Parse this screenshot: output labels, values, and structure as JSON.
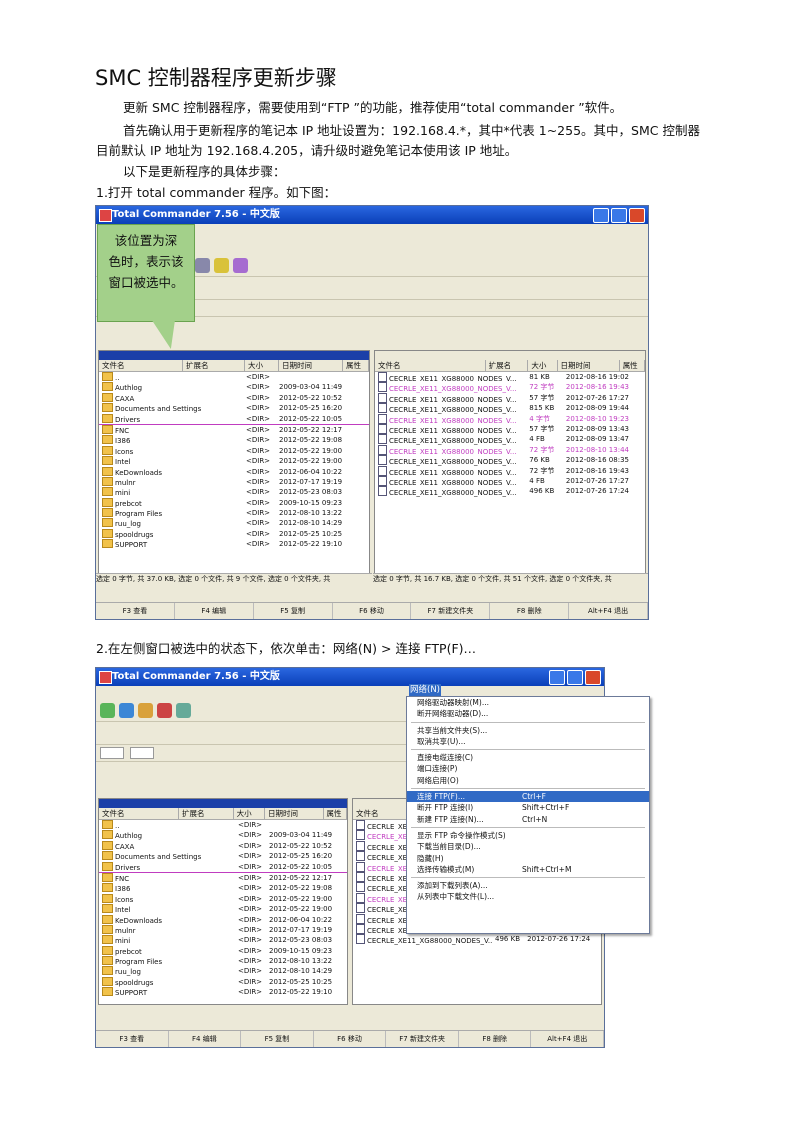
{
  "document": {
    "title": "SMC 控制器程序更新步骤",
    "para1": "更新 SMC 控制器程序，需要使用到“FTP ”的功能，推荐使用“total commander ”软件。",
    "para2_line1": "首先确认用于更新程序的笔记本 IP 地址设置为：192.168.4.*，其中*代表 1~255。其中，SMC 控制器",
    "para2_line2": "目前默认 IP 地址为 192.168.4.205，请升级时避免笔记本使用该 IP 地址。",
    "para3": "以下是更新程序的具体步骤：",
    "step1": "1.打开 total commander   程序。如下图：",
    "step2": "2.在左侧窗口被选中的状态下，依次单击：网络(N)     >  连接 FTP(F)…"
  },
  "screenshot1": {
    "window_title": "Total Commander 7.56 - 中文版",
    "callout": [
      "该位置为深",
      "色时，表示该",
      "窗口被选中。"
    ],
    "left_status": "选定 0 字节, 共 37.0 KB, 选定 0 个文件, 共 9 个文件, 选定 0 个文件夹, 共",
    "right_status": "选定 0 字节, 共 16.7 KB, 选定 0 个文件, 共 51 个文件, 选定 0 个文件夹, 共",
    "fn_keys": [
      "F3 查看",
      "F4 编辑",
      "F5 复制",
      "F6 移动",
      "F7 新建文件夹",
      "F8 删除",
      "Alt+F4 退出"
    ]
  },
  "screenshot2": {
    "window_title": "Total Commander 7.56 - 中文版",
    "network_menu": "网络(N)",
    "menu_items": [
      {
        "label": "网络驱动器映射(M)...",
        "shortcut": ""
      },
      {
        "label": "断开网络驱动器(D)...",
        "shortcut": ""
      },
      {
        "sep": true
      },
      {
        "label": "共享当前文件夹(S)...",
        "shortcut": ""
      },
      {
        "label": "取消共享(U)...",
        "shortcut": ""
      },
      {
        "sep": true
      },
      {
        "label": "直接电缆连接(C)",
        "shortcut": ""
      },
      {
        "label": "端口连接(P)",
        "shortcut": ""
      },
      {
        "label": "网络启用(O)",
        "shortcut": ""
      },
      {
        "sep": true
      },
      {
        "label": "连接 FTP(F)...",
        "shortcut": "Ctrl+F",
        "selected": true
      },
      {
        "label": "断开 FTP 连接(I)",
        "shortcut": "Shift+Ctrl+F"
      },
      {
        "label": "新建 FTP 连接(N)...",
        "shortcut": "Ctrl+N"
      },
      {
        "sep": true
      },
      {
        "label": "显示 FTP 命令操作模式(S)",
        "shortcut": ""
      },
      {
        "label": "下载当前目录(D)...",
        "shortcut": ""
      },
      {
        "label": "隐藏(H)",
        "shortcut": ""
      },
      {
        "label": "选择传输模式(M)",
        "shortcut": "Shift+Ctrl+M"
      },
      {
        "sep": true
      },
      {
        "label": "添加到下载列表(A)...",
        "shortcut": ""
      },
      {
        "label": "从列表中下载文件(L)...",
        "shortcut": ""
      }
    ],
    "fn_keys": [
      "F3 查看",
      "F4 编辑",
      "F5 复制",
      "F6 移动",
      "F7 新建文件夹",
      "F8 删除",
      "Alt+F4 退出"
    ]
  },
  "left_files": [
    {
      "name": "..",
      "size": "<DIR>",
      "date": ""
    },
    {
      "name": "Authlog",
      "size": "<DIR>",
      "date": "2009-03-04 11:49"
    },
    {
      "name": "CAXA",
      "size": "<DIR>",
      "date": "2012-05-22 10:52"
    },
    {
      "name": "Documents and Settings",
      "size": "<DIR>",
      "date": "2012-05-25 16:20"
    },
    {
      "name": "Drivers",
      "size": "<DIR>",
      "date": "2012-05-22 10:05"
    },
    {
      "name": "FNC",
      "size": "<DIR>",
      "date": "2012-05-22 12:17"
    },
    {
      "name": "I386",
      "size": "<DIR>",
      "date": "2012-05-22 19:08"
    },
    {
      "name": "Icons",
      "size": "<DIR>",
      "date": "2012-05-22 19:00"
    },
    {
      "name": "Intel",
      "size": "<DIR>",
      "date": "2012-05-22 19:00"
    },
    {
      "name": "KeDownloads",
      "size": "<DIR>",
      "date": "2012-06-04 10:22"
    },
    {
      "name": "mulnr",
      "size": "<DIR>",
      "date": "2012-07-17 19:19"
    },
    {
      "name": "mini",
      "size": "<DIR>",
      "date": "2012-05-23 08:03"
    },
    {
      "name": "prebcot",
      "size": "<DIR>",
      "date": "2009-10-15 09:23"
    },
    {
      "name": "Program Files",
      "size": "<DIR>",
      "date": "2012-08-10 13:22"
    },
    {
      "name": "ruu_log",
      "size": "<DIR>",
      "date": "2012-08-10 14:29"
    },
    {
      "name": "spooldrugs",
      "size": "<DIR>",
      "date": "2012-05-25 10:25"
    },
    {
      "name": "SUPPORT",
      "size": "<DIR>",
      "date": "2012-05-22 19:10"
    }
  ],
  "right_files": [
    {
      "name": "CECRLE_XE11_XG88000_NODES_V...",
      "size": "81 KB",
      "date": "2012-08-16 19:02"
    },
    {
      "name": "CECRLE_XE11_XG88000_NODES_V...",
      "size": "72 字节",
      "date": "2012-08-16 19:43"
    },
    {
      "name": "CECRLE_XE11_XG88000_NODES_V...",
      "size": "57 字节",
      "date": "2012-07-26 17:27"
    },
    {
      "name": "CECRLE_XE11_XG88000_NODES_V...",
      "size": "815 KB",
      "date": "2012-08-09 19:44"
    },
    {
      "name": "CECRLE_XE11_XG88000_NODES_V...",
      "size": "4 字节",
      "date": "2012-08-10 19:23"
    },
    {
      "name": "CECRLE_XE11_XG88000_NODES_V...",
      "size": "57 字节",
      "date": "2012-08-09 13:43"
    },
    {
      "name": "CECRLE_XE11_XG88000_NODES_V...",
      "size": "4 FB",
      "date": "2012-08-09 13:47"
    },
    {
      "name": "CECRLE_XE11_XG88000_NODES_V...",
      "size": "72 字节",
      "date": "2012-08-10 13:44"
    },
    {
      "name": "CECRLE_XE11_XG88000_NODES_V...",
      "size": "76 KB",
      "date": "2012-08-16 08:35"
    },
    {
      "name": "CECRLE_XE11_XG88000_NODES_V...",
      "size": "72 字节",
      "date": "2012-08-16 19:43"
    },
    {
      "name": "CECRLE_XE11_XG88000_NODES_V...",
      "size": "4 FB",
      "date": "2012-07-26 17:27"
    },
    {
      "name": "CECRLE_XE11_XG88000_NODES_V...",
      "size": "496 KB",
      "date": "2012-07-26 17:24"
    }
  ],
  "colors": {
    "accent": "#0a3fb8",
    "callout": "#a3d08a",
    "selected_menu": "#316ac5"
  }
}
